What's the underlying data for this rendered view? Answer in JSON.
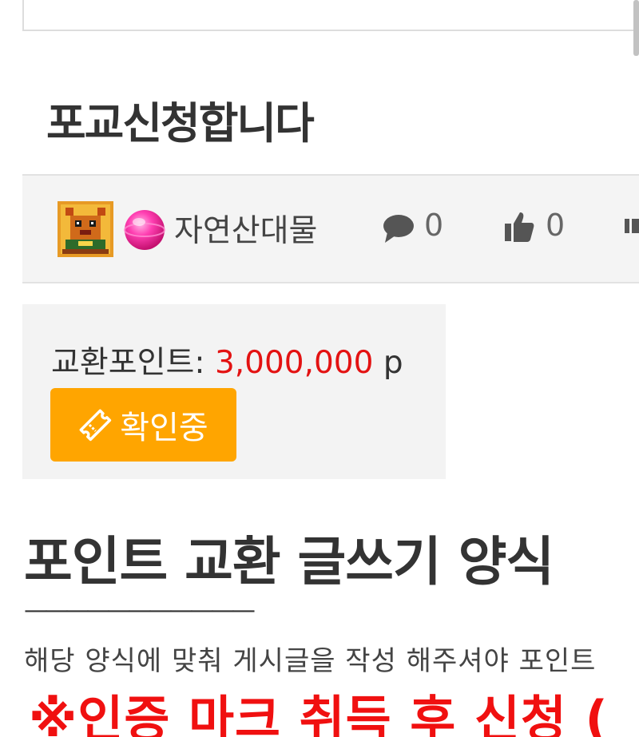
{
  "post": {
    "title": "포교신청합니다",
    "author": "자연산대물",
    "comment_count": "0",
    "like_count": "0"
  },
  "points": {
    "label": "교환포인트:",
    "value": "3,000,000",
    "unit": "p",
    "status_button_label": "확인중"
  },
  "content": {
    "heading": "포인트 교환 글쓰기 양식",
    "divider": "———————————",
    "instruction": "해당 양식에 맞춰 게시글을 작성 해주셔야 포인트",
    "warning": "※인증 마크 취득 후 신청 ("
  },
  "icons": {
    "avatar": "pixel-avatar-icon",
    "level": "pink-orb-level-icon",
    "comment": "speech-bubble-icon",
    "like": "thumbs-up-icon",
    "status": "ticket-icon"
  },
  "colors": {
    "accent_orange": "#ffa500",
    "point_red": "#e31212",
    "warning_red": "#f01010"
  }
}
